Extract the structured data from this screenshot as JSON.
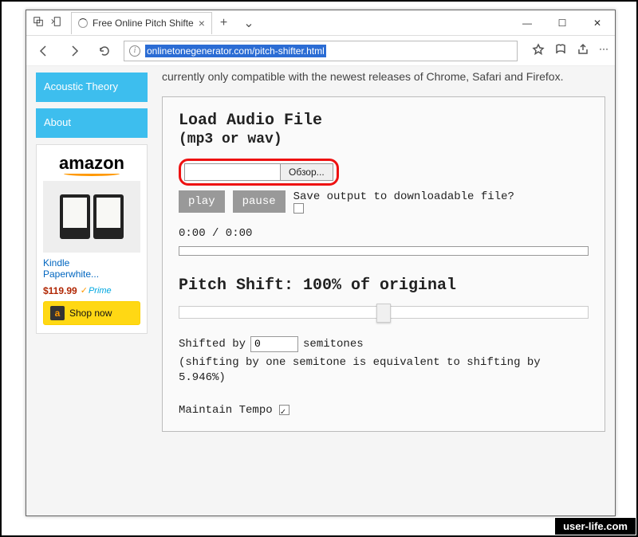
{
  "browser": {
    "tab_title": "Free Online Pitch Shifte",
    "url": "onlinetonegenerator.com/pitch-shifter.html"
  },
  "sidebar": {
    "items": [
      {
        "label": "Acoustic Theory"
      },
      {
        "label": "About"
      }
    ]
  },
  "ad": {
    "brand": "amazon",
    "product_line1": "Kindle",
    "product_line2": "Paperwhite...",
    "price": "$119.99",
    "prime": "Prime",
    "shop": "Shop now"
  },
  "page": {
    "intro": "currently only compatible with the newest releases of Chrome, Safari and Firefox.",
    "load_title": "Load Audio File",
    "load_sub": "(mp3 or wav)",
    "browse_btn": "Обзор...",
    "play": "play",
    "pause": "pause",
    "save_label": "Save output to downloadable file?",
    "time": "0:00 / 0:00",
    "pitch_title": "Pitch Shift: 100% of original",
    "shifted_by_pre": "Shifted by",
    "semitones_value": "0",
    "shifted_by_post": "semitones",
    "shift_hint": "(shifting by one semitone is equivalent to shifting by 5.946%)",
    "tempo": "Maintain Tempo"
  },
  "watermark": "user-life.com"
}
